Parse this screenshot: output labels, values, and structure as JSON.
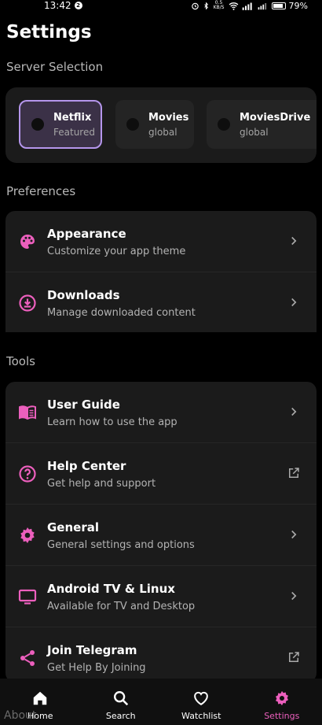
{
  "status_bar": {
    "time": "13:42",
    "notif_count": "2",
    "speed": "0.5 KB/S",
    "battery": "79%"
  },
  "page": {
    "title": "Settings"
  },
  "server_section": {
    "label": "Server Selection",
    "servers": [
      {
        "name": "Netflix",
        "sub": "Featured"
      },
      {
        "name": "Movies",
        "sub": "global"
      },
      {
        "name": "MoviesDrive",
        "sub": "global"
      }
    ]
  },
  "preferences": {
    "label": "Preferences",
    "items": [
      {
        "title": "Appearance",
        "sub": "Customize your app theme"
      },
      {
        "title": "Downloads",
        "sub": "Manage downloaded content"
      }
    ]
  },
  "tools": {
    "label": "Tools",
    "items": [
      {
        "title": "User Guide",
        "sub": "Learn how to use the app"
      },
      {
        "title": "Help Center",
        "sub": "Get help and support"
      },
      {
        "title": "General",
        "sub": "General settings and options"
      },
      {
        "title": "Android TV & Linux",
        "sub": "Available for TV and Desktop"
      },
      {
        "title": "Join Telegram",
        "sub": "Get Help By Joining"
      }
    ]
  },
  "about_label": "About",
  "nav": {
    "home": "Home",
    "search": "Search",
    "watchlist": "Watchlist",
    "settings": "Settings"
  },
  "colors": {
    "accent": "#ec5fbd",
    "selected_border": "#b596ec",
    "card": "#1b1b1b",
    "background": "#000000"
  },
  "icons": {
    "appearance": "palette-icon",
    "downloads": "download-icon",
    "user_guide": "book-icon",
    "help_center": "help-circle-icon",
    "general": "gear-icon",
    "android_tv": "tv-icon",
    "telegram": "share-icon",
    "chevron": "chevron-right-icon",
    "external": "open-external-icon"
  }
}
